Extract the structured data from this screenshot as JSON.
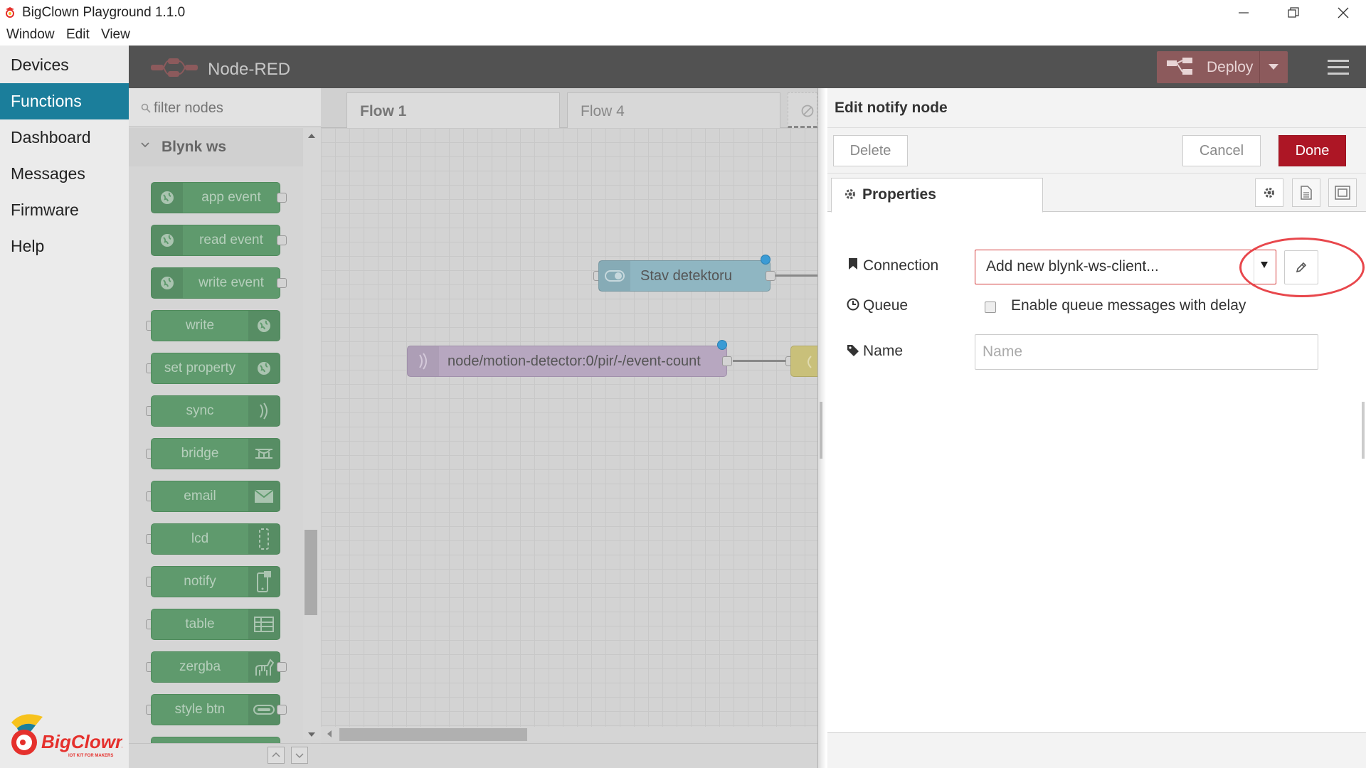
{
  "window": {
    "title": "BigClown Playground 1.1.0"
  },
  "menubar": [
    "Window",
    "Edit",
    "View"
  ],
  "nav": {
    "items": [
      {
        "label": "Devices"
      },
      {
        "label": "Functions",
        "active": true
      },
      {
        "label": "Dashboard"
      },
      {
        "label": "Messages"
      },
      {
        "label": "Firmware"
      },
      {
        "label": "Help"
      }
    ],
    "logo_text": "BigClown",
    "logo_tagline": "IOT KIT FOR MAKERS"
  },
  "nodered": {
    "title": "Node-RED",
    "deploy_label": "Deploy"
  },
  "palette": {
    "filter_placeholder": "filter nodes",
    "category": "Blynk ws",
    "nodes": [
      {
        "label": "app event",
        "icon": "globe-icon",
        "side": "left"
      },
      {
        "label": "read event",
        "icon": "globe-icon",
        "side": "left"
      },
      {
        "label": "write event",
        "icon": "globe-icon",
        "side": "left"
      },
      {
        "label": "write",
        "icon": "globe-icon",
        "side": "right"
      },
      {
        "label": "set property",
        "icon": "globe-icon",
        "side": "right"
      },
      {
        "label": "sync",
        "icon": "signal-icon",
        "side": "right"
      },
      {
        "label": "bridge",
        "icon": "bridge-icon",
        "side": "right"
      },
      {
        "label": "email",
        "icon": "envelope-icon",
        "side": "right"
      },
      {
        "label": "lcd",
        "icon": "lcd-icon",
        "side": "right"
      },
      {
        "label": "notify",
        "icon": "phone-icon",
        "side": "right"
      },
      {
        "label": "table",
        "icon": "table-icon",
        "side": "right"
      },
      {
        "label": "zergba",
        "icon": "zebra-icon",
        "side": "right"
      },
      {
        "label": "style btn",
        "icon": "button-icon",
        "side": "right"
      }
    ]
  },
  "workspace": {
    "tabs": [
      {
        "label": "Flow 1",
        "active": true
      },
      {
        "label": "Flow 4"
      }
    ],
    "flow_nodes": [
      {
        "label": "Stav detektoru"
      },
      {
        "label": "node/motion-detector:0/pir/-/event-count"
      }
    ]
  },
  "tray": {
    "title": "Edit notify node",
    "delete_label": "Delete",
    "cancel_label": "Cancel",
    "done_label": "Done",
    "properties_label": "Properties",
    "connection_label": "Connection",
    "connection_value": "Add new blynk-ws-client...",
    "queue_label": "Queue",
    "queue_text": "Enable queue messages with delay",
    "name_label": "Name",
    "name_placeholder": "Name"
  },
  "colors": {
    "accent": "#1b7e9b",
    "done": "#ad1625",
    "highlight": "#e8474c"
  }
}
